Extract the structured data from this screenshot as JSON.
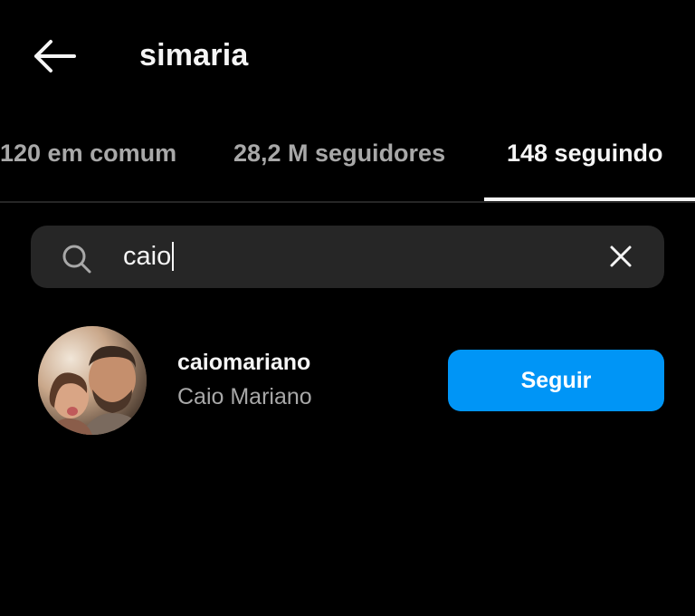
{
  "header": {
    "title": "simaria",
    "back_icon": "arrow-left-icon"
  },
  "tabs": [
    {
      "label": "120 em comum",
      "active": false
    },
    {
      "label": "28,2 M seguidores",
      "active": false
    },
    {
      "label": "148 seguindo",
      "active": true
    }
  ],
  "search": {
    "value": "caio",
    "search_icon": "search-icon",
    "clear_icon": "close-icon"
  },
  "results": [
    {
      "username": "caiomariano",
      "full_name": "Caio Mariano",
      "follow_label": "Seguir"
    }
  ],
  "colors": {
    "background": "#000000",
    "primary_text": "#f5f5f5",
    "secondary_text": "#a8a8a8",
    "search_bg": "#262626",
    "follow_button": "#0095f6"
  }
}
